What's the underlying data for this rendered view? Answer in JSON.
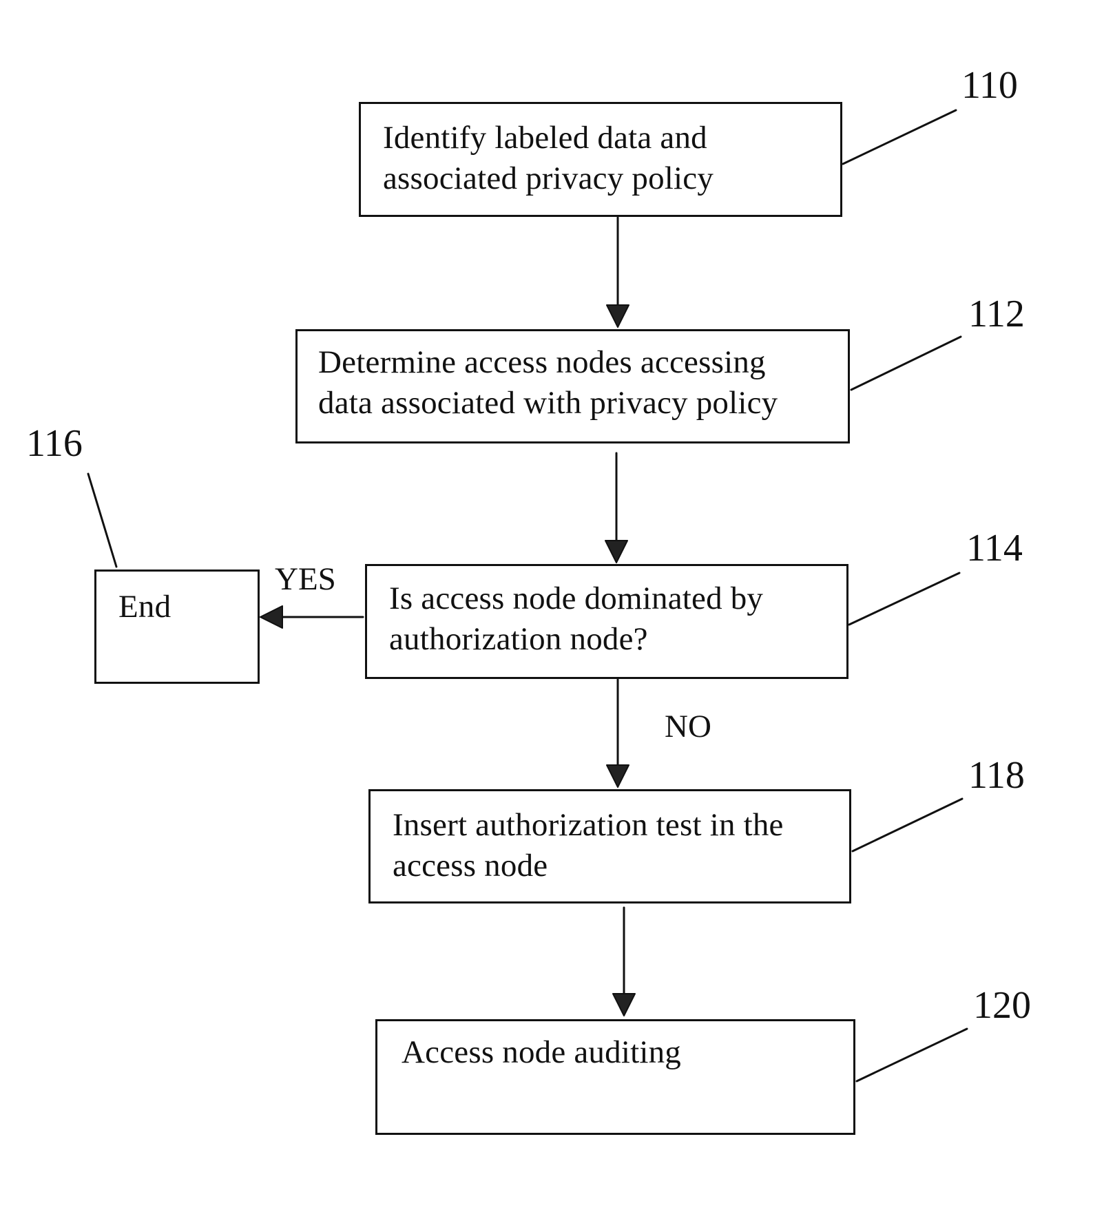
{
  "diagram": {
    "type": "flowchart",
    "nodes": [
      {
        "id": "110",
        "ref": "110",
        "lines": [
          "Identify labeled data and",
          "associated privacy policy"
        ]
      },
      {
        "id": "112",
        "ref": "112",
        "lines": [
          "Determine access nodes accessing",
          "data associated with privacy policy"
        ]
      },
      {
        "id": "114",
        "ref": "114",
        "lines": [
          "Is access node dominated by",
          "authorization node?"
        ]
      },
      {
        "id": "116",
        "ref": "116",
        "lines": [
          "End"
        ]
      },
      {
        "id": "118",
        "ref": "118",
        "lines": [
          "Insert authorization test in the",
          "access node"
        ]
      },
      {
        "id": "120",
        "ref": "120",
        "lines": [
          "Access node auditing"
        ]
      }
    ],
    "edges": [
      {
        "from": "110",
        "to": "112",
        "label": ""
      },
      {
        "from": "112",
        "to": "114",
        "label": ""
      },
      {
        "from": "114",
        "to": "116",
        "label": "YES"
      },
      {
        "from": "114",
        "to": "118",
        "label": "NO"
      },
      {
        "from": "118",
        "to": "120",
        "label": ""
      }
    ],
    "branch_labels": {
      "yes": "YES",
      "no": "NO"
    }
  },
  "colors": {
    "ink": "#111111",
    "background": "#ffffff"
  }
}
